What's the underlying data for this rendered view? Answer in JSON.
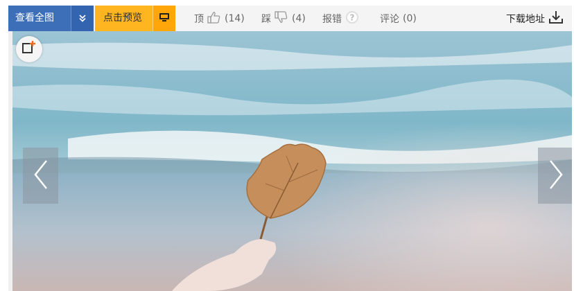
{
  "toolbar": {
    "view_all": {
      "label": "查看全图",
      "icon": "double-chevron-down-icon"
    },
    "preview": {
      "label": "点击预览",
      "icon": "monitor-icon"
    },
    "top": {
      "label": "顶",
      "count": "(14)",
      "icon": "thumbs-up-icon"
    },
    "step": {
      "label": "踩",
      "count": "(4)",
      "icon": "thumbs-down-icon"
    },
    "report": {
      "label": "报错",
      "icon": "question-icon"
    },
    "comment": {
      "label": "评论",
      "count": "(0)"
    },
    "download": {
      "label": "下载地址",
      "icon": "download-icon"
    }
  },
  "viewer": {
    "add_icon": "add-collection-icon",
    "prev_icon": "chevron-left-icon",
    "next_icon": "chevron-right-icon"
  },
  "colors": {
    "view_all_bg": "#3d6fb8",
    "preview_bg": "#ffb51f",
    "toolbar_bg": "#f4f4f4",
    "accent_orange": "#f26a1b"
  }
}
